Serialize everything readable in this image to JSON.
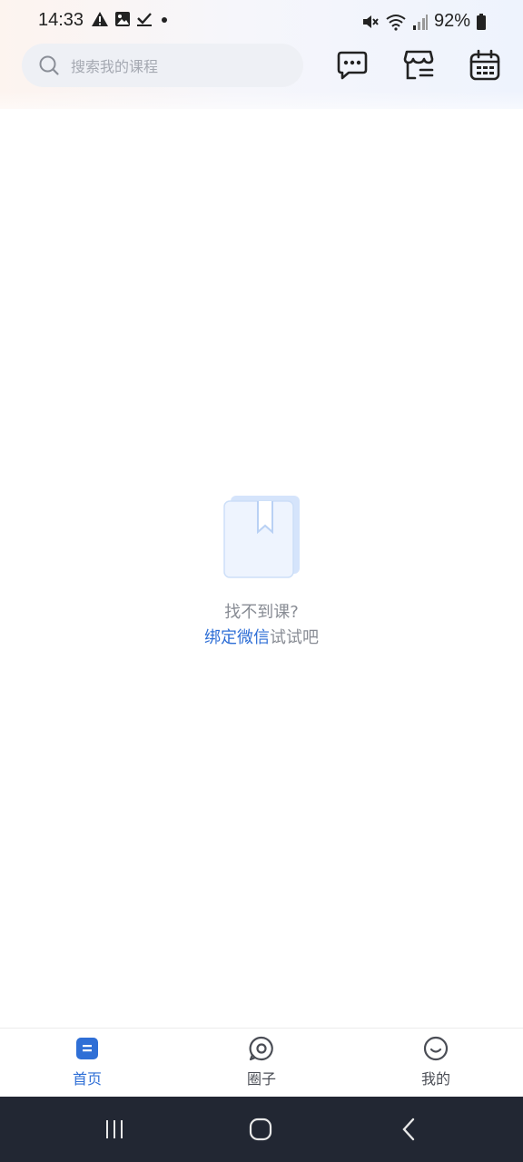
{
  "status_bar": {
    "time": "14:33",
    "battery": "92%",
    "left_icons": [
      "warning-icon",
      "image-icon",
      "check-icon",
      "dot-icon"
    ],
    "right_icons": [
      "mute-icon",
      "wifi-icon",
      "signal-icon",
      "battery-icon"
    ]
  },
  "header": {
    "search_placeholder": "搜索我的课程",
    "buttons": [
      "message-icon",
      "store-icon",
      "calendar-icon"
    ]
  },
  "empty_state": {
    "title": "找不到课?",
    "link_text": "绑定微信",
    "hint_suffix": "试试吧"
  },
  "bottom_nav": {
    "items": [
      {
        "label": "首页",
        "icon": "home-icon",
        "active": true
      },
      {
        "label": "圈子",
        "icon": "circle-chat-icon",
        "active": false
      },
      {
        "label": "我的",
        "icon": "profile-smile-icon",
        "active": false
      }
    ]
  },
  "colors": {
    "accent": "#2f6fd6",
    "system_nav": "#222733"
  }
}
